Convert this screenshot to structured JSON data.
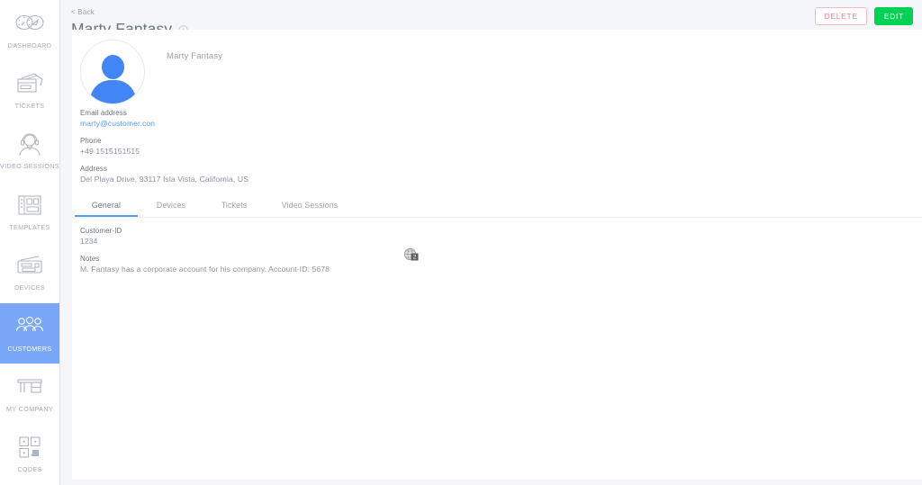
{
  "sidebar": {
    "items": [
      {
        "label": "DASHBOARD",
        "icon": "dashboard-gauge-icon",
        "active": false
      },
      {
        "label": "TICKETS",
        "icon": "tickets-icon",
        "active": false
      },
      {
        "label": "VIDEO SESSIONS",
        "icon": "headset-agent-icon",
        "active": false
      },
      {
        "label": "TEMPLATES",
        "icon": "templates-grid-icon",
        "active": false
      },
      {
        "label": "DEVICES",
        "icon": "devices-printer-icon",
        "active": false
      },
      {
        "label": "CUSTOMERS",
        "icon": "customers-people-icon",
        "active": true
      },
      {
        "label": "MY COMPANY",
        "icon": "my-company-desk-icon",
        "active": false
      },
      {
        "label": "CODES",
        "icon": "codes-qr-icon",
        "active": false
      }
    ],
    "active_color": "#7aa7f7",
    "label_color": "#a8adb8"
  },
  "header": {
    "back_label": "< Back",
    "title": "Marty Fantasy",
    "info_icon": "info-circle-icon",
    "delete_label": "DELETE",
    "edit_label": "EDIT",
    "delete_color": "#ef7b8d",
    "edit_color": "#00d254"
  },
  "profile": {
    "avatar_icon": "user-avatar-icon",
    "name": "Marty Fantasy",
    "fields": [
      {
        "label": "Email address",
        "value": "marty@customer.con",
        "is_link": true
      },
      {
        "label": "Phone",
        "value": "+49 1515151515",
        "is_link": false
      },
      {
        "label": "Address",
        "value": "Del Playa Drive, 93117 Isla Vista, California, US",
        "is_link": false
      }
    ]
  },
  "tabs": [
    {
      "label": "General",
      "active": true
    },
    {
      "label": "Devices",
      "active": false
    },
    {
      "label": "Tickets",
      "active": false
    },
    {
      "label": "Video Sessions",
      "active": false
    }
  ],
  "general_tab": {
    "fields": [
      {
        "label": "Customer-ID",
        "value": "1234"
      },
      {
        "label": "Notes",
        "value": "M. Fantasy has a corporate account for his company. Account-ID: 5678"
      }
    ]
  },
  "cursor": {
    "icon": "globe-badge-cursor-icon"
  }
}
